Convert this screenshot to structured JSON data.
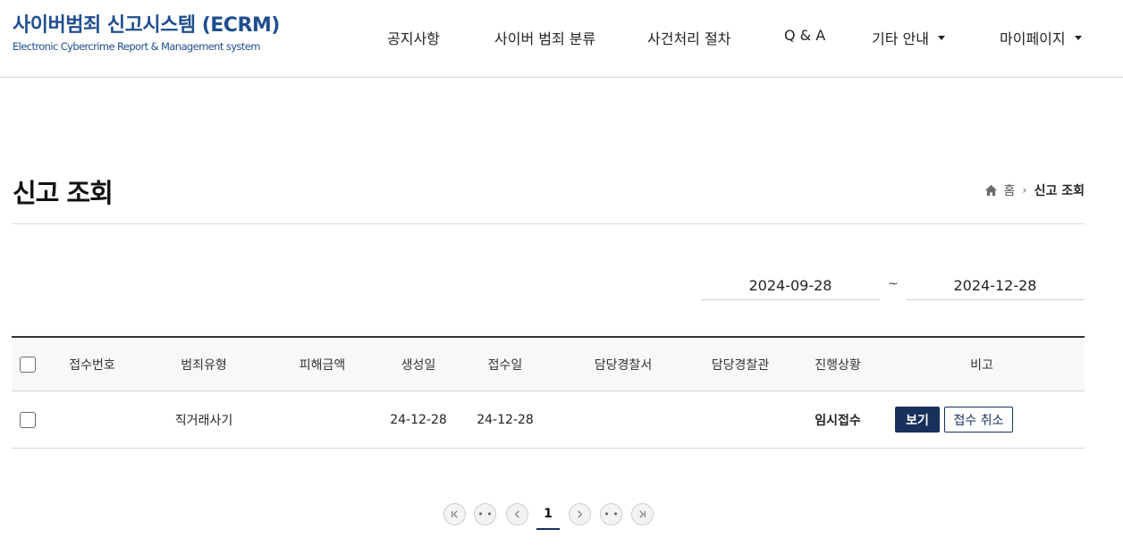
{
  "header": {
    "logo_title": "사이버범죄 신고시스템 (ECRM)",
    "logo_subtitle": "Electronic Cybercrime Report & Management system",
    "nav": [
      {
        "label": "공지사항",
        "dropdown": false
      },
      {
        "label": "사이버 범죄 분류",
        "dropdown": false
      },
      {
        "label": "사건처리 절차",
        "dropdown": false
      },
      {
        "label": "Q & A",
        "dropdown": false
      },
      {
        "label": "기타 안내",
        "dropdown": true
      },
      {
        "label": "마이페이지",
        "dropdown": true
      }
    ]
  },
  "page": {
    "title": "신고 조회",
    "breadcrumb": {
      "home": "홈",
      "current": "신고 조회"
    }
  },
  "filter": {
    "start_date": "2024-09-28",
    "separator": "~",
    "end_date": "2024-12-28"
  },
  "table": {
    "columns": [
      "접수번호",
      "범죄유형",
      "피해금액",
      "생성일",
      "접수일",
      "담당경찰서",
      "담당경찰관",
      "진행상황",
      "비고"
    ],
    "rows": [
      {
        "receipt_no": "",
        "crime_type": "직거래사기",
        "damage_amount": "",
        "created": "24-12-28",
        "received": "24-12-28",
        "police_station": "",
        "officer": "",
        "status": "임시접수",
        "view_label": "보기",
        "cancel_label": "접수 취소"
      }
    ]
  },
  "pagination": {
    "current_page": "1",
    "dots": "• •"
  },
  "colors": {
    "brand": "#1f4e8f",
    "button_primary": "#17305c"
  }
}
